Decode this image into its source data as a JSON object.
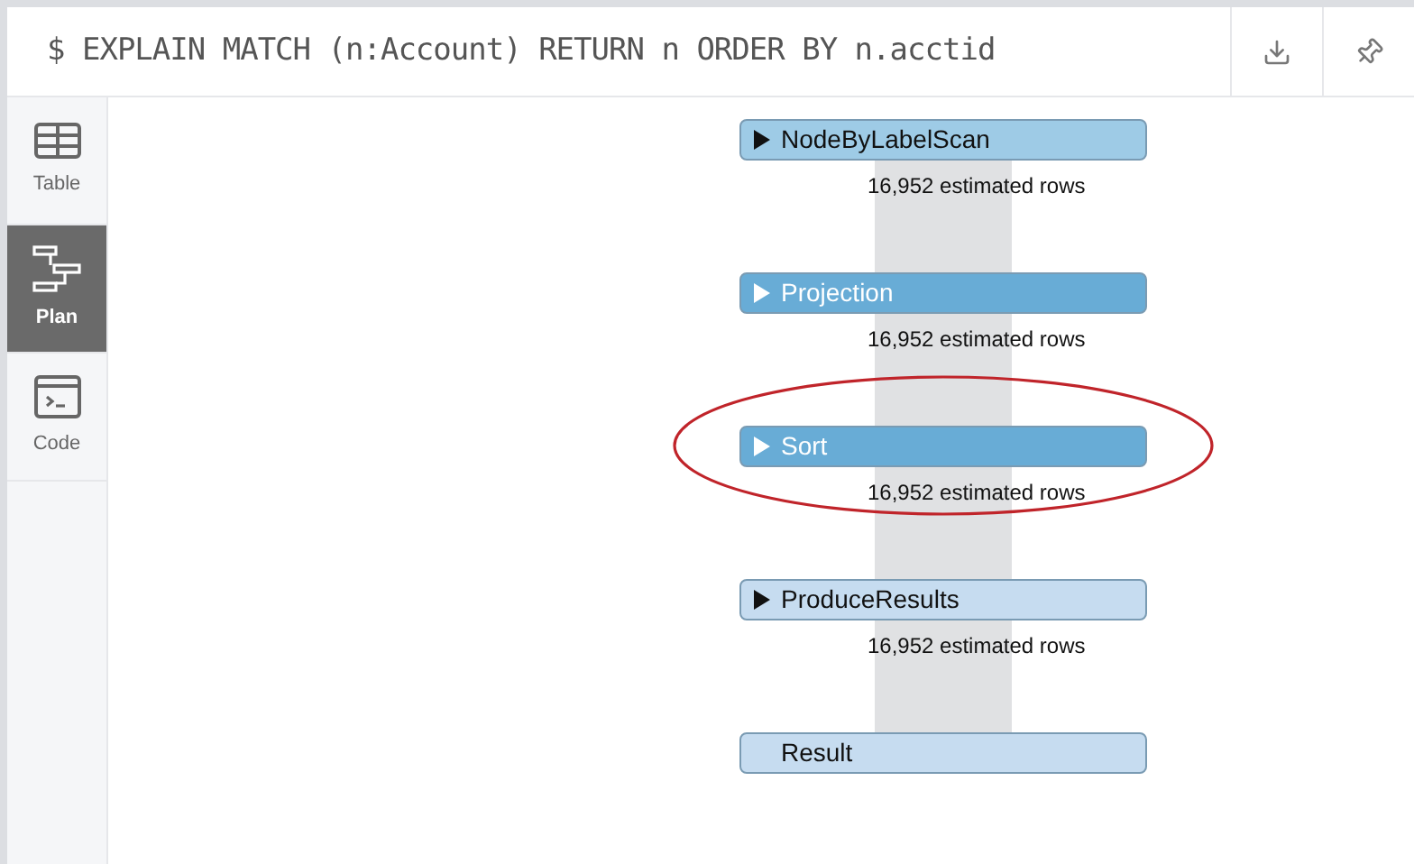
{
  "query": {
    "text": "$ EXPLAIN MATCH (n:Account) RETURN n ORDER BY n.acctid"
  },
  "sidebar": {
    "items": [
      {
        "kind": "table",
        "label": "Table",
        "selected": false
      },
      {
        "kind": "plan",
        "label": "Plan",
        "selected": true
      },
      {
        "kind": "code",
        "label": "Code",
        "selected": false
      }
    ]
  },
  "plan": {
    "operators": [
      {
        "name": "NodeByLabelScan",
        "expandable": true,
        "color": "#9ecbe6",
        "light_text": false,
        "highlighted": false,
        "rows": "16,952 estimated rows"
      },
      {
        "name": "Projection",
        "expandable": true,
        "color": "#68acd6",
        "light_text": true,
        "highlighted": false,
        "rows": "16,952 estimated rows"
      },
      {
        "name": "Sort",
        "expandable": true,
        "color": "#68acd6",
        "light_text": true,
        "highlighted": true,
        "rows": "16,952 estimated rows"
      },
      {
        "name": "ProduceResults",
        "expandable": true,
        "color": "#c6dcf0",
        "light_text": false,
        "highlighted": false,
        "rows": "16,952 estimated rows"
      },
      {
        "name": "Result",
        "expandable": false,
        "color": "#c6dcf0",
        "light_text": false,
        "highlighted": false
      }
    ]
  }
}
